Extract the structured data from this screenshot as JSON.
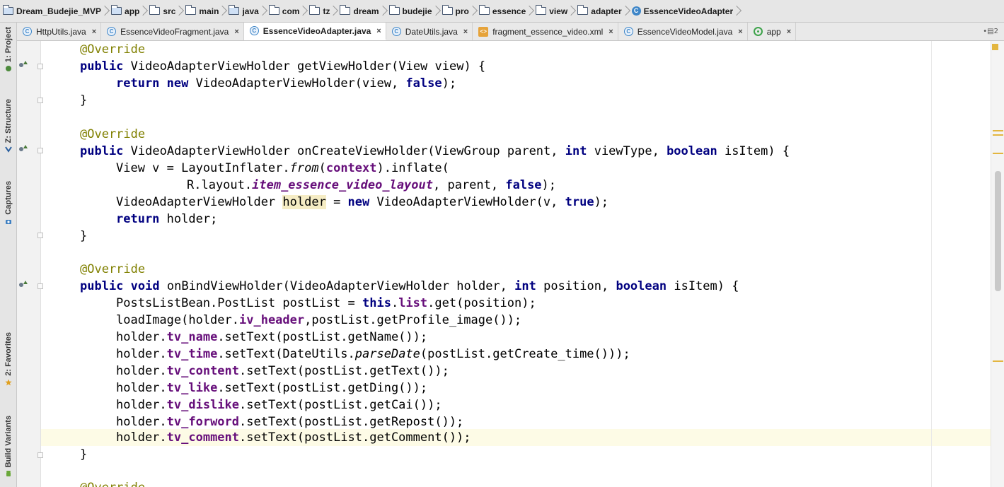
{
  "breadcrumb": {
    "items": [
      {
        "label": "Dream_Budejie_MVP",
        "icon": "project-folder-icon"
      },
      {
        "label": "app",
        "icon": "module-folder-icon"
      },
      {
        "label": "src",
        "icon": "folder-icon"
      },
      {
        "label": "main",
        "icon": "folder-icon"
      },
      {
        "label": "java",
        "icon": "source-folder-icon"
      },
      {
        "label": "com",
        "icon": "package-icon"
      },
      {
        "label": "tz",
        "icon": "package-icon"
      },
      {
        "label": "dream",
        "icon": "package-icon"
      },
      {
        "label": "budejie",
        "icon": "package-icon"
      },
      {
        "label": "pro",
        "icon": "package-icon"
      },
      {
        "label": "essence",
        "icon": "package-icon"
      },
      {
        "label": "view",
        "icon": "package-icon"
      },
      {
        "label": "adapter",
        "icon": "package-icon"
      },
      {
        "label": "EssenceVideoAdapter",
        "icon": "class-icon"
      }
    ]
  },
  "tabs": [
    {
      "label": "HttpUtils.java",
      "icon": "class-icon",
      "active": false
    },
    {
      "label": "EssenceVideoFragment.java",
      "icon": "class-icon",
      "active": false
    },
    {
      "label": "EssenceVideoAdapter.java",
      "icon": "class-icon",
      "active": true
    },
    {
      "label": "DateUtils.java",
      "icon": "class-icon",
      "active": false
    },
    {
      "label": "fragment_essence_video.xml",
      "icon": "xml-file-icon",
      "active": false
    },
    {
      "label": "EssenceVideoModel.java",
      "icon": "class-icon",
      "active": false
    },
    {
      "label": "app",
      "icon": "app-module-icon",
      "active": false
    }
  ],
  "tab_close_glyph": "×",
  "tabs_overflow": "•▤2",
  "tool_windows": {
    "project": "1: Project",
    "structure": "Z: Structure",
    "captures": "Captures",
    "favorites": "2: Favorites",
    "build_variants": "Build Variants"
  },
  "colors": {
    "keyword": "#000080",
    "annotation": "#808000",
    "field": "#660e7a",
    "current_line": "#fdfbe6",
    "highlight": "#f5ecc4",
    "warning_marker": "#e3b640"
  },
  "code": {
    "l0": [
      "@Override"
    ],
    "l1": [
      "public",
      " VideoAdapterViewHolder getViewHolder(View view) {"
    ],
    "l2": [
      "return",
      " ",
      "new",
      " VideoAdapterViewHolder(view, ",
      "false",
      ");"
    ],
    "l3": [
      "}"
    ],
    "l4": [
      "@Override"
    ],
    "l5": [
      "public",
      " VideoAdapterViewHolder onCreateViewHolder(ViewGroup parent, ",
      "int",
      " viewType, ",
      "boolean",
      " isItem) {"
    ],
    "l6": [
      "View v = LayoutInflater.",
      "from",
      "(",
      "context",
      ").inflate("
    ],
    "l7": [
      "R.layout.",
      "item_essence_video_layout",
      ", parent, ",
      "false",
      ");"
    ],
    "l8": [
      "VideoAdapterViewHolder ",
      "holder",
      " = ",
      "new",
      " VideoAdapterViewHolder(v, ",
      "true",
      ");"
    ],
    "l9": [
      "return",
      " holder;"
    ],
    "l10": [
      "}"
    ],
    "l11": [
      "@Override"
    ],
    "l12": [
      "public",
      " ",
      "void",
      " onBindViewHolder(VideoAdapterViewHolder holder, ",
      "int",
      " position, ",
      "boolean",
      " isItem) {"
    ],
    "l13": [
      "PostsListBean.PostList postList = ",
      "this",
      ".",
      "list",
      ".get(position);"
    ],
    "l14": [
      "loadImage(holder.",
      "iv_header",
      ",postList.getProfile_image());"
    ],
    "l15": [
      "holder.",
      "tv_name",
      ".setText(postList.getName());"
    ],
    "l16": [
      "holder.",
      "tv_time",
      ".setText(DateUtils.",
      "parseDate",
      "(postList.getCreate_time()));"
    ],
    "l17": [
      "holder.",
      "tv_content",
      ".setText(postList.getText());"
    ],
    "l18": [
      "holder.",
      "tv_like",
      ".setText(postList.getDing());"
    ],
    "l19": [
      "holder.",
      "tv_dislike",
      ".setText(postList.getCai());"
    ],
    "l20": [
      "holder.",
      "tv_forword",
      ".setText(postList.getRepost());"
    ],
    "l21": [
      "holder.",
      "tv_comment",
      ".setText(postList.getComment());"
    ],
    "l22": [
      "}"
    ],
    "l23": [
      "@Override"
    ]
  }
}
